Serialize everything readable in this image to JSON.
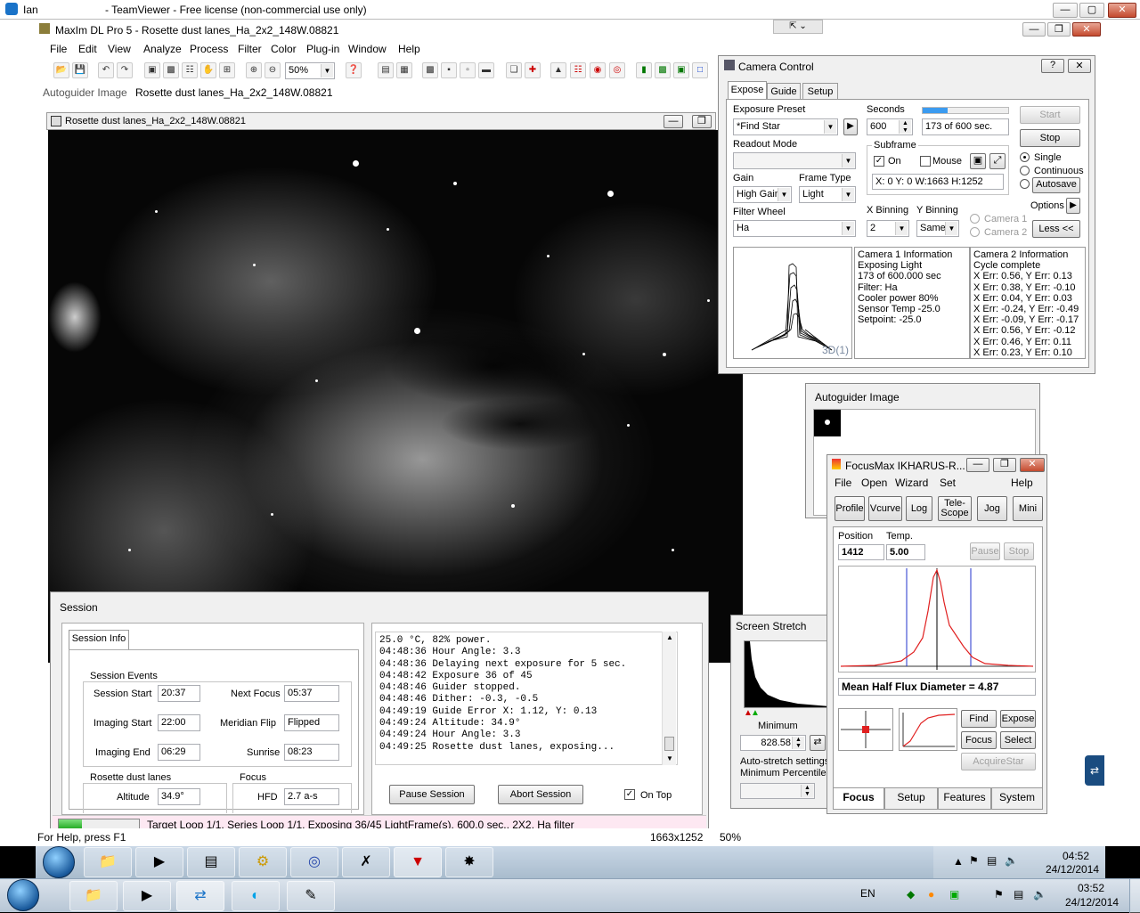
{
  "teamviewer": {
    "user": "Ian",
    "title": "- TeamViewer - Free license (non-commercial use only)"
  },
  "maxim": {
    "title": "MaxIm DL Pro 5 - Rosette dust lanes_Ha_2x2_148W.08821",
    "menu": [
      "File",
      "Edit",
      "View",
      "Analyze",
      "Process",
      "Filter",
      "Color",
      "Plug-in",
      "Window",
      "Help"
    ],
    "zoom": "50%",
    "status_label": "Autoguider Image",
    "status_value": "Rosette dust lanes_Ha_2x2_148W.08821",
    "statusbar_left": "For Help, press F1",
    "statusbar_dims": "1663x1252",
    "statusbar_zoom": "50%"
  },
  "image_window": {
    "title": "Rosette dust lanes_Ha_2x2_148W.08821"
  },
  "camera_control": {
    "title": "Camera Control",
    "help_glyph": "?",
    "close_glyph": "✕",
    "tabs": [
      "Expose",
      "Guide",
      "Setup"
    ],
    "exposure_preset_label": "Exposure Preset",
    "exposure_preset_value": "*Find Star",
    "readout_mode_label": "Readout Mode",
    "readout_mode_value": "",
    "gain_label": "Gain",
    "gain_value": "High Gain",
    "frame_type_label": "Frame Type",
    "frame_type_value": "Light",
    "filter_wheel_label": "Filter Wheel",
    "filter_wheel_value": "Ha",
    "seconds_label": "Seconds",
    "seconds_value": "600",
    "progress_text": "173 of 600 sec.",
    "progress_fraction": 0.288,
    "subframe_label": "Subframe",
    "subframe_on_label": "On",
    "subframe_on": true,
    "subframe_mouse_label": "Mouse",
    "subframe_mouse": false,
    "subframe_coords": "X:   0 Y:   0 W:1663 H:1252",
    "x_binning_label": "X Binning",
    "x_binning_value": "2",
    "y_binning_label": "Y Binning",
    "y_binning_value": "Same",
    "camera1_label": "Camera 1",
    "camera2_label": "Camera 2",
    "start_label": "Start",
    "stop_label": "Stop",
    "single_label": "Single",
    "continuous_label": "Continuous",
    "autosave_label": "Autosave",
    "options_label": "Options",
    "less_label": "Less <<",
    "plot_label": "3D(1)",
    "cam1_info": [
      "Camera 1 Information",
      "Exposing Light",
      "173 of 600.000 sec",
      "Filter: Ha",
      "Cooler power 80%",
      "Sensor Temp -25.0",
      "Setpoint: -25.0"
    ],
    "cam2_info": [
      "Camera 2 Information",
      "Cycle complete",
      "X Err: 0.56, Y Err: 0.13",
      "X Err: 0.38, Y Err: -0.10",
      "X Err: 0.04, Y Err: 0.03",
      "X Err: -0.24, Y Err: -0.49",
      "X Err: -0.09, Y Err: -0.17",
      "X Err: 0.56, Y Err: -0.12",
      "X Err: 0.46, Y Err: 0.11",
      "X Err: 0.23, Y Err: 0.10"
    ]
  },
  "autoguider": {
    "title": "Autoguider Image"
  },
  "focusmax": {
    "title": "FocusMax  IKHARUS-R...",
    "menu": [
      "File",
      "Open",
      "Wizard",
      "Set",
      "Help"
    ],
    "buttons": [
      "Profile",
      "Vcurve",
      "Log",
      "Tele-\nScope",
      "Jog",
      "Mini"
    ],
    "position_label": "Position",
    "position_value": "1412",
    "temp_label": "Temp.",
    "temp_value": "5.00",
    "pause_label": "Pause",
    "stop_label": "Stop",
    "hfd_text": "Mean Half Flux Diameter = 4.87",
    "find_label": "Find",
    "expose_label": "Expose",
    "focus_label": "Focus",
    "select_label": "Select",
    "acquire_label": "AcquireStar",
    "tabs": [
      "Focus",
      "Setup",
      "Features",
      "System"
    ]
  },
  "screen_stretch": {
    "title": "Screen Stretch",
    "minimum_label": "Minimum",
    "minimum_value": "828.58",
    "autostretch_label": "Auto-stretch settings",
    "min_percentile_label": "Minimum Percentile",
    "percentile_value": ""
  },
  "session": {
    "title": "Session",
    "tab": "Session Info",
    "events_label": "Session Events",
    "session_start_label": "Session Start",
    "session_start": "20:37",
    "next_focus_label": "Next Focus",
    "next_focus": "05:37",
    "imaging_start_label": "Imaging Start",
    "imaging_start": "22:00",
    "meridian_flip_label": "Meridian Flip",
    "meridian_flip": "Flipped",
    "imaging_end_label": "Imaging End",
    "imaging_end": "06:29",
    "sunrise_label": "Sunrise",
    "sunrise": "08:23",
    "target_group_label": "Rosette dust lanes",
    "altitude_label": "Altitude",
    "altitude": "34.9°",
    "focus_group_label": "Focus",
    "hfd_label": "HFD",
    "hfd": "2.7 a-s",
    "log": [
      "25.0 °C, 82% power.",
      "04:48:36 Hour Angle: 3.3",
      "04:48:36 Delaying next exposure for 5 sec.",
      "04:48:42 Exposure 36 of 45",
      "04:48:46 Guider stopped.",
      "04:48:46 Dither: -0.3, -0.5",
      "04:49:19 Guide Error X: 1.12, Y: 0.13",
      "04:49:24 Altitude: 34.9°",
      "04:49:24 Hour Angle: 3.3",
      "04:49:25 Rosette dust lanes, exposing..."
    ],
    "pause_label": "Pause Session",
    "abort_label": "Abort Session",
    "ontop_label": "On Top",
    "ontop": true,
    "progress_text": "Target Loop 1/1, Series Loop 1/1, Exposing 36/45 LightFrame(s), 600.0 sec., 2X2, Ha filter",
    "progress_fraction": 0.29
  },
  "remote_tray": {
    "time": "04:52",
    "date": "24/12/2014"
  },
  "local_tray": {
    "lang": "EN",
    "time": "03:52",
    "date": "24/12/2014"
  }
}
